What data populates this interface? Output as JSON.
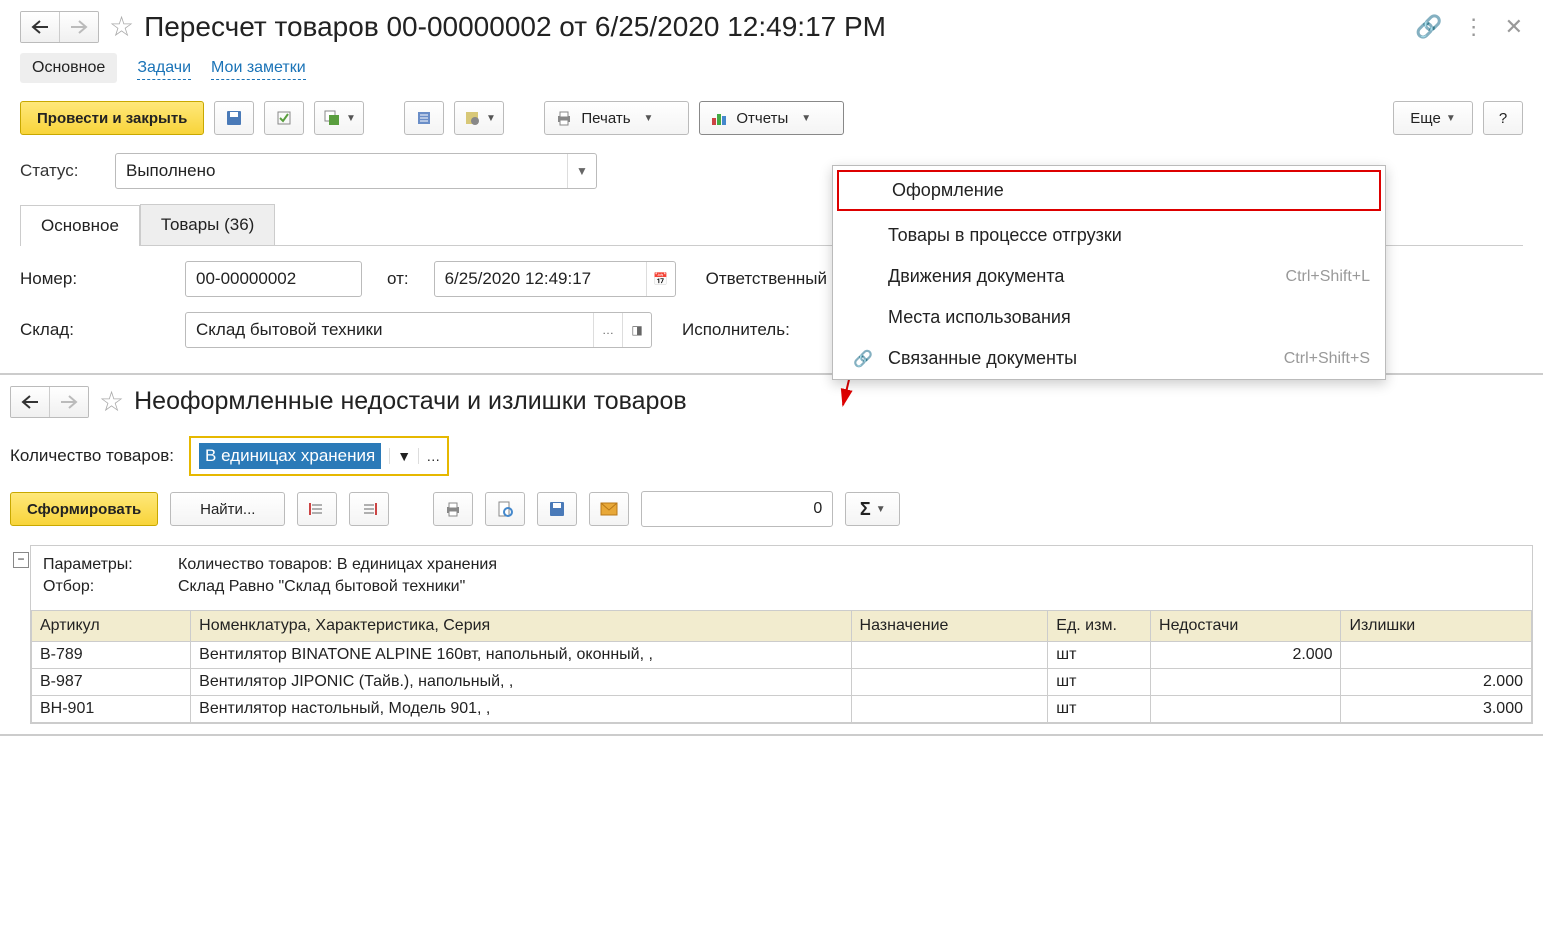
{
  "window1": {
    "title": "Пересчет товаров 00-00000002 от 6/25/2020 12:49:17 PM",
    "top_tabs": {
      "main": "Основное",
      "tasks": "Задачи",
      "notes": "Мои заметки"
    },
    "toolbar": {
      "post_close": "Провести и закрыть",
      "print": "Печать",
      "reports": "Отчеты",
      "more": "Еще",
      "help": "?"
    },
    "status": {
      "label": "Статус:",
      "value": "Выполнено"
    },
    "tabs": {
      "main": "Основное",
      "goods": "Товары (36)"
    },
    "fields": {
      "number_label": "Номер:",
      "number": "00-00000002",
      "from_label": "от:",
      "date": "6/25/2020 12:49:17",
      "responsible_label": "Ответственный",
      "warehouse_label": "Склад:",
      "warehouse": "Склад бытовой техники",
      "executor_label": "Исполнитель:"
    },
    "reports_menu": [
      {
        "label": "Оформление",
        "shortcut": "",
        "highlight": true
      },
      {
        "label": "Товары в процессе отгрузки",
        "shortcut": ""
      },
      {
        "label": "Движения документа",
        "shortcut": "Ctrl+Shift+L"
      },
      {
        "label": "Места использования",
        "shortcut": ""
      },
      {
        "label": "Связанные документы",
        "shortcut": "Ctrl+Shift+S",
        "icon": "link-icon"
      }
    ]
  },
  "window2": {
    "title": "Неоформленные недостачи и излишки товаров",
    "filter_label": "Количество товаров:",
    "filter_value": "В единицах хранения",
    "toolbar": {
      "generate": "Сформировать",
      "find": "Найти...",
      "num": "0"
    },
    "report": {
      "params_label": "Параметры:",
      "params_value": "Количество товаров: В единицах хранения",
      "filter_label": "Отбор:",
      "filter_value": "Склад Равно \"Склад бытовой техники\"",
      "columns": [
        "Артикул",
        "Номенклатура, Характеристика, Серия",
        "Назначение",
        "Ед. изм.",
        "Недостачи",
        "Излишки"
      ],
      "rows": [
        {
          "art": "В-789",
          "name": "Вентилятор BINATONE ALPINE 160вт, напольный, оконный, ,",
          "dest": "",
          "unit": "шт",
          "short": "2.000",
          "over": ""
        },
        {
          "art": "В-987",
          "name": "Вентилятор JIPONIC (Тайв.), напольный, ,",
          "dest": "",
          "unit": "шт",
          "short": "",
          "over": "2.000"
        },
        {
          "art": "ВН-901",
          "name": "Вентилятор настольный, Модель 901, ,",
          "dest": "",
          "unit": "шт",
          "short": "",
          "over": "3.000"
        }
      ]
    }
  }
}
